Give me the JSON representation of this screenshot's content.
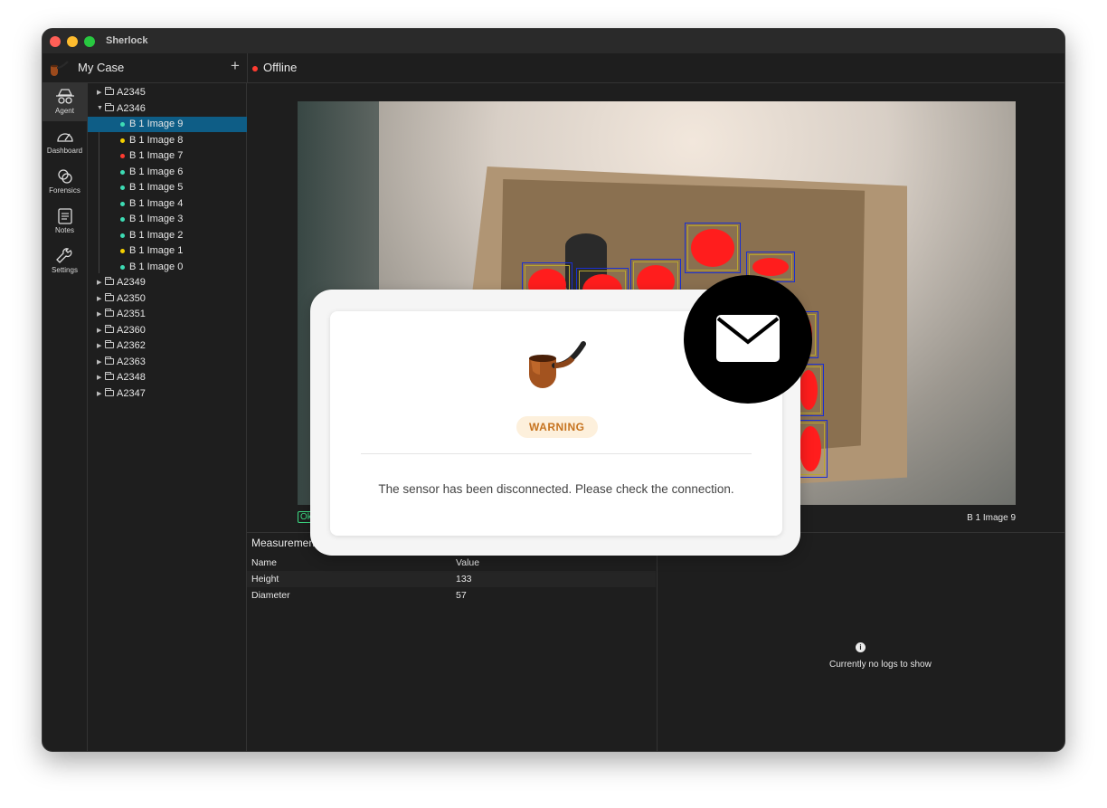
{
  "app": {
    "title": "Sherlock"
  },
  "case": {
    "title": "My Case",
    "add_label": "+"
  },
  "status": {
    "text": "Offline",
    "color": "#ff3b30"
  },
  "nav": [
    {
      "label": "Agent",
      "icon": "agent-icon"
    },
    {
      "label": "Dashboard",
      "icon": "gauge-icon"
    },
    {
      "label": "Forensics",
      "icon": "forensics-icon"
    },
    {
      "label": "Notes",
      "icon": "notes-icon"
    },
    {
      "label": "Settings",
      "icon": "wrench-icon"
    }
  ],
  "tree": [
    {
      "label": "A2345",
      "expanded": false
    },
    {
      "label": "A2346",
      "expanded": true,
      "children": [
        {
          "label": "B 1 Image 9",
          "status": "#3ddcb4",
          "selected": true
        },
        {
          "label": "B 1 Image 8",
          "status": "#f5d000"
        },
        {
          "label": "B 1 Image 7",
          "status": "#ff3b30"
        },
        {
          "label": "B 1 Image 6",
          "status": "#3ddcb4"
        },
        {
          "label": "B 1 Image 5",
          "status": "#3ddcb4"
        },
        {
          "label": "B 1 Image 4",
          "status": "#3ddcb4"
        },
        {
          "label": "B 1 Image 3",
          "status": "#3ddcb4"
        },
        {
          "label": "B 1 Image 2",
          "status": "#3ddcb4"
        },
        {
          "label": "B 1 Image 1",
          "status": "#f5d000"
        },
        {
          "label": "B 1 Image 0",
          "status": "#3ddcb4"
        }
      ]
    },
    {
      "label": "A2349",
      "expanded": false
    },
    {
      "label": "A2350",
      "expanded": false
    },
    {
      "label": "A2351",
      "expanded": false
    },
    {
      "label": "A2360",
      "expanded": false
    },
    {
      "label": "A2362",
      "expanded": false
    },
    {
      "label": "A2363",
      "expanded": false
    },
    {
      "label": "A2348",
      "expanded": false
    },
    {
      "label": "A2347",
      "expanded": false
    }
  ],
  "image": {
    "status_badge": "Ok",
    "caption": "B 1 Image 9"
  },
  "measurements": {
    "title": "Measurements",
    "columns": [
      "Name",
      "Value"
    ],
    "rows": [
      [
        "Height",
        "133"
      ],
      [
        "Diameter",
        "57"
      ]
    ]
  },
  "logs": {
    "empty_text": "Currently no logs to show",
    "icon": "info-icon"
  },
  "modal": {
    "badge": "WARNING",
    "message": "The sensor has been disconnected. Please check the connection.",
    "badge_color": "#c6731f"
  },
  "notification": {
    "icon": "mail-icon"
  }
}
